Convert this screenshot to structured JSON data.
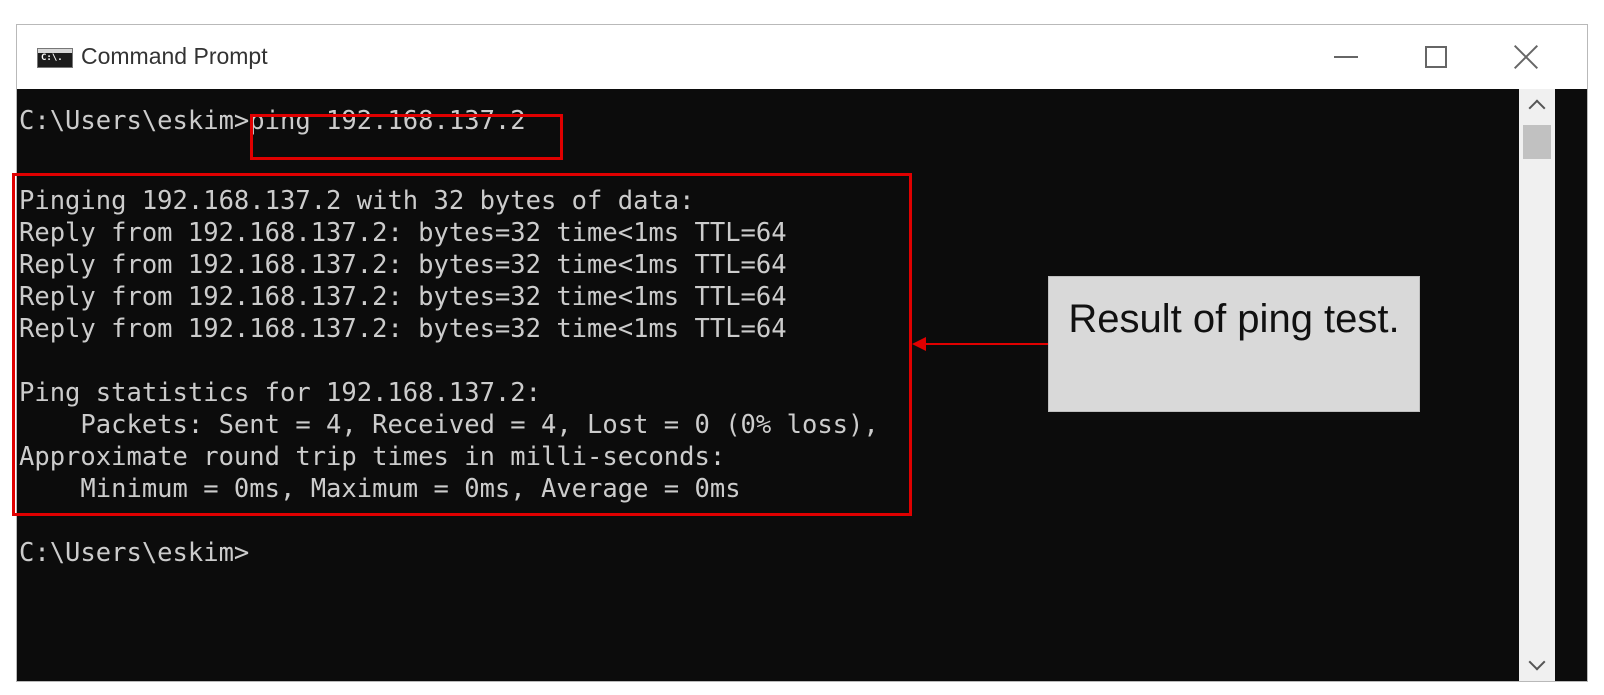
{
  "window": {
    "title": "Command Prompt",
    "minimize_label": "—",
    "maximize_label": "☐",
    "close_label": "✕"
  },
  "console": {
    "lines": [
      "C:\\Users\\eskim>ping 192.168.137.2",
      "Pinging 192.168.137.2 with 32 bytes of data:",
      "Reply from 192.168.137.2: bytes=32 time<1ms TTL=64",
      "Reply from 192.168.137.2: bytes=32 time<1ms TTL=64",
      "Reply from 192.168.137.2: bytes=32 time<1ms TTL=64",
      "Reply from 192.168.137.2: bytes=32 time<1ms TTL=64",
      "Ping statistics for 192.168.137.2:",
      "    Packets: Sent = 4, Received = 4, Lost = 0 (0% loss),",
      "Approximate round trip times in milli-seconds:",
      "    Minimum = 0ms, Maximum = 0ms, Average = 0ms",
      "C:\\Users\\eskim>"
    ]
  },
  "annotation": {
    "callout_text": "Result of ping test.",
    "highlight_color": "#e00000",
    "callout_bg": "#d9d9d9"
  },
  "colors": {
    "console_bg": "#0c0c0c",
    "console_text": "#cccccc"
  }
}
